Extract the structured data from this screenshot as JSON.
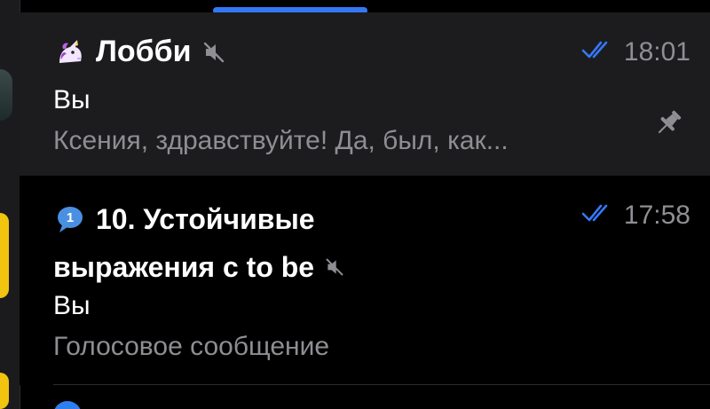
{
  "chats": [
    {
      "title": "Лобби",
      "icon": "unicorn-icon",
      "muted": true,
      "time": "18:01",
      "read_status": "double-check-icon",
      "sender": "Вы",
      "preview": "Ксения, здравствуйте! Да, был, как...",
      "pinned": true
    },
    {
      "title_line1": "10. Устойчивые",
      "title_line2": "выражения с to be",
      "icon": "speech-bubble-number-icon",
      "badge_number": "1",
      "muted": true,
      "time": "17:58",
      "read_status": "double-check-icon",
      "sender": "Вы",
      "preview": "Голосовое сообщение",
      "pinned": false
    }
  ],
  "colors": {
    "background": "#000000",
    "pinned_row": "#1c1c1e",
    "accent_blue": "#3478f6",
    "secondary_text": "#8e8e93",
    "avatar_yellow": "#f1c40f"
  }
}
